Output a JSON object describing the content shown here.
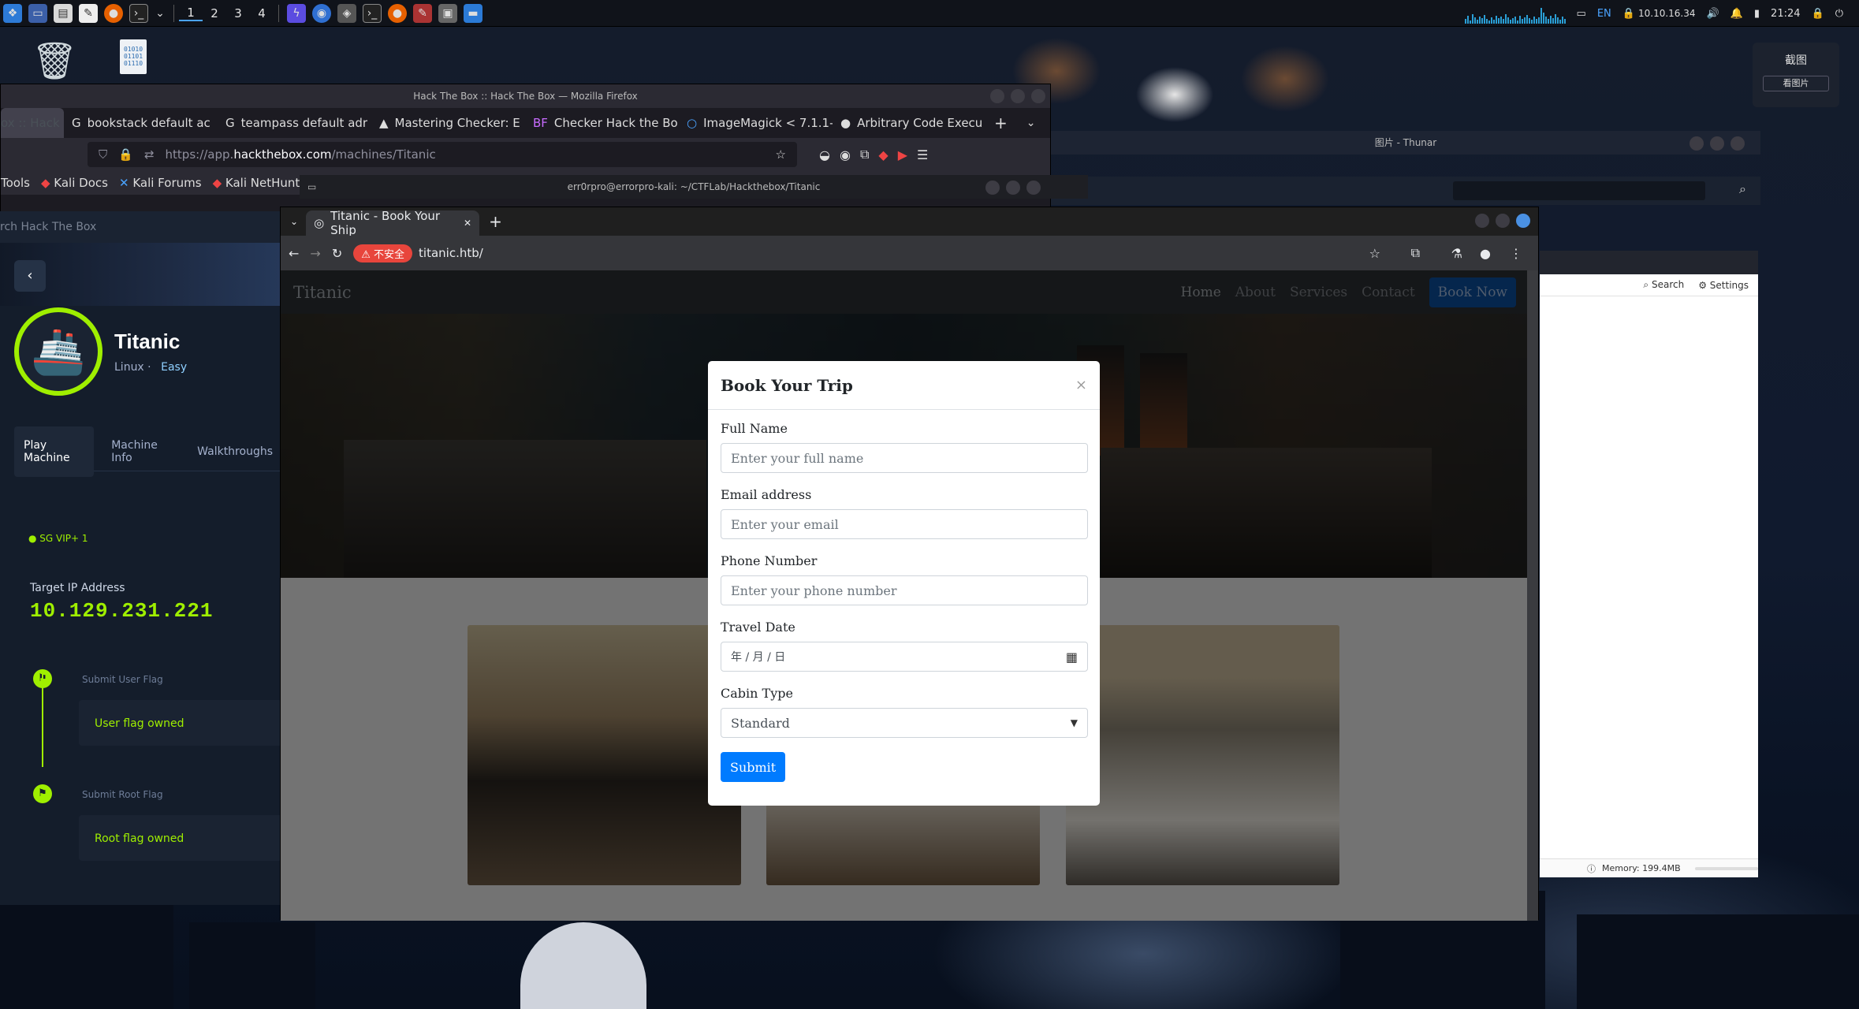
{
  "panel": {
    "workspaces": [
      "1",
      "2",
      "3",
      "4"
    ],
    "lang": "EN",
    "ip": "10.10.16.34",
    "time": "21:24"
  },
  "firefox": {
    "window_title": "Hack The Box :: Hack The Box — Mozilla Firefox",
    "tabs": [
      {
        "label": "ox :: Hack"
      },
      {
        "label": "bookstack default ac"
      },
      {
        "label": "teampass default adr"
      },
      {
        "label": "Mastering Checker: E"
      },
      {
        "label": "Checker Hack the Bo"
      },
      {
        "label": "ImageMagick < 7.1.1-"
      },
      {
        "label": "Arbitrary Code Execu"
      }
    ],
    "url_prefix": "https://app.",
    "url_domain": "hackthebox.com",
    "url_path": "/machines/Titanic",
    "bookmarks": [
      "Tools",
      "Kali Docs",
      "Kali Forums",
      "Kali NetHunter"
    ]
  },
  "terminal": {
    "title": "err0rpro@errorpro-kali: ~/CTFLab/Hackthebox/Titanic"
  },
  "thunar": {
    "title": "图片 - Thunar",
    "search": "Search",
    "settings": "Settings",
    "memory": "Memory: 199.4MB"
  },
  "widget": {
    "title": "截图",
    "button": "看图片"
  },
  "htb": {
    "search": "rch Hack The Box",
    "machine_name": "Titanic",
    "os": "Linux",
    "difficulty": "Easy",
    "tabs": [
      "Play Machine",
      "Machine Info",
      "Walkthroughs"
    ],
    "server": "SG VIP+ 1",
    "target_ip_label": "Target IP Address",
    "target_ip": "10.129.231.221",
    "user_flag_label": "Submit User Flag",
    "user_flag_status": "User flag owned",
    "root_flag_label": "Submit Root Flag",
    "root_flag_status": "Root flag owned"
  },
  "chrome": {
    "tab_title": "Titanic - Book Your Ship",
    "insecure_label": "不安全",
    "url": "titanic.htb/"
  },
  "site": {
    "brand": "Titanic",
    "nav": [
      "Home",
      "About",
      "Services",
      "Contact"
    ],
    "book_now": "Book Now"
  },
  "modal": {
    "title": "Book Your Trip",
    "full_name_label": "Full Name",
    "full_name_placeholder": "Enter your full name",
    "email_label": "Email address",
    "email_placeholder": "Enter your email",
    "phone_label": "Phone Number",
    "phone_placeholder": "Enter your phone number",
    "date_label": "Travel Date",
    "date_value": "年 / 月 / 日",
    "cabin_label": "Cabin Type",
    "cabin_value": "Standard",
    "submit": "Submit"
  },
  "colors": {
    "htb_green": "#9fef00",
    "bootstrap_blue": "#007bff",
    "chrome_insecure": "#e8453c"
  }
}
